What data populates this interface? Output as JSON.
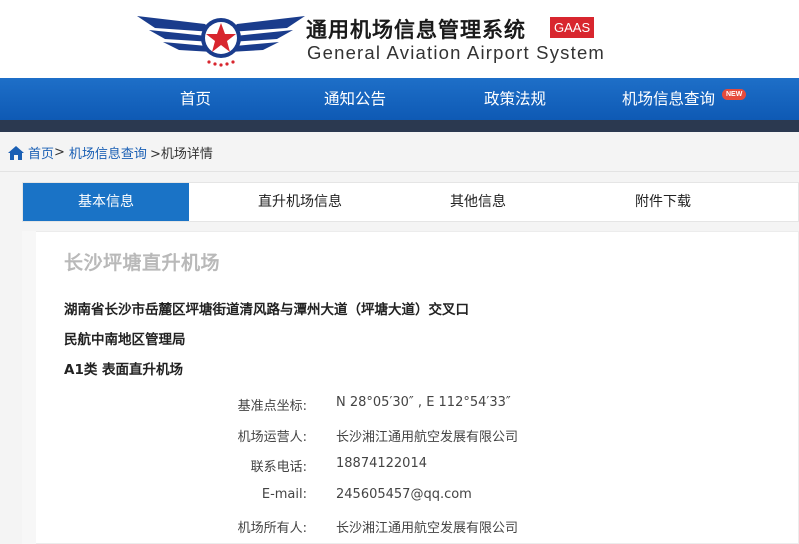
{
  "header": {
    "title_cn": "通用机场信息管理系统",
    "badge": "GAAS",
    "title_en": "General Aviation Airport System",
    "colors": {
      "brand_blue": "#1a3c8c",
      "badge_red": "#d8262e",
      "star_red": "#d8262e"
    }
  },
  "nav": {
    "items": [
      {
        "label": "首页"
      },
      {
        "label": "通知公告"
      },
      {
        "label": "政策法规"
      },
      {
        "label": "机场信息查询"
      }
    ],
    "new_badge": "NEW",
    "colors": {
      "bar": "#1565c0",
      "underbar": "#2b3950"
    }
  },
  "breadcrumb": {
    "home_icon": "home-icon",
    "home": "首页",
    "sep1": ">",
    "query": "机场信息查询",
    "current": ">机场详情"
  },
  "tabs": [
    {
      "label": "基本信息",
      "active": true
    },
    {
      "label": "直升机场信息",
      "active": false
    },
    {
      "label": "其他信息",
      "active": false
    },
    {
      "label": "附件下载",
      "active": false
    }
  ],
  "airport": {
    "name": "长沙坪塘直升机场",
    "address": "湖南省长沙市岳麓区坪塘街道清风路与潭州大道（坪塘大道）交叉口",
    "authority": "民航中南地区管理局",
    "category": "A1类 表面直升机场",
    "fields": [
      {
        "label": "基准点坐标:",
        "value": "N 28°05′30″ , E 112°54′33″"
      },
      {
        "label": "机场运营人:",
        "value": "长沙湘江通用航空发展有限公司"
      },
      {
        "label": "联系电话:",
        "value": "18874122014"
      },
      {
        "label": "E-mail:",
        "value": "245605457@qq.com"
      },
      {
        "label": "机场所有人:",
        "value": "长沙湘江通用航空发展有限公司"
      }
    ]
  }
}
